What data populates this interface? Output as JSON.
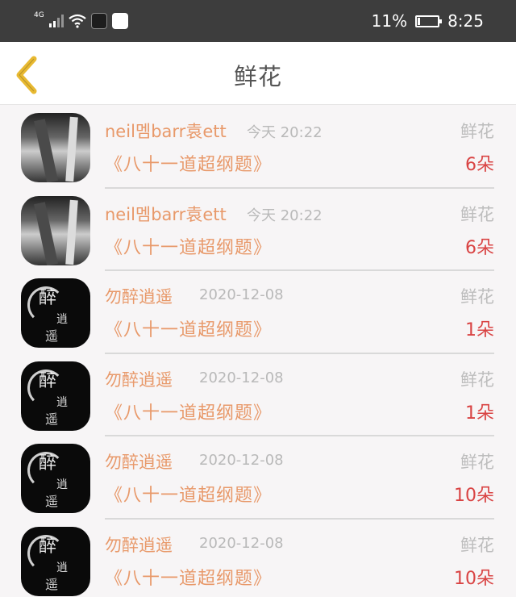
{
  "status_bar": {
    "network": "4G",
    "battery_percent": "11%",
    "time": "8:25",
    "icons": [
      "signal-icon",
      "wifi-icon",
      "app-icon",
      "paw-app-icon",
      "battery-charging-icon"
    ]
  },
  "nav": {
    "title": "鲜花",
    "back_icon": "chevron-left-icon",
    "accent": "#e8b931"
  },
  "items": [
    {
      "name": "neil멤barr袁ett",
      "time": "今天 20:22",
      "kind": "鲜花",
      "book": "《八十一道超纲题》",
      "count": "6朵"
    },
    {
      "name": "neil멤barr袁ett",
      "time": "今天 20:22",
      "kind": "鲜花",
      "book": "《八十一道超纲题》",
      "count": "6朵"
    },
    {
      "name": "勿醉逍遥",
      "time": "2020-12-08",
      "kind": "鲜花",
      "book": "《八十一道超纲题》",
      "count": "1朵"
    },
    {
      "name": "勿醉逍遥",
      "time": "2020-12-08",
      "kind": "鲜花",
      "book": "《八十一道超纲题》",
      "count": "1朵"
    },
    {
      "name": "勿醉逍遥",
      "time": "2020-12-08",
      "kind": "鲜花",
      "book": "《八十一道超纲题》",
      "count": "10朵"
    },
    {
      "name": "勿醉逍遥",
      "time": "2020-12-08",
      "kind": "鲜花",
      "book": "《八十一道超纲题》",
      "count": "10朵"
    }
  ],
  "colors": {
    "name_text": "#e8996a",
    "count_text": "#d94343",
    "muted_text": "#b9b9b9",
    "background": "#f7f5f6"
  }
}
